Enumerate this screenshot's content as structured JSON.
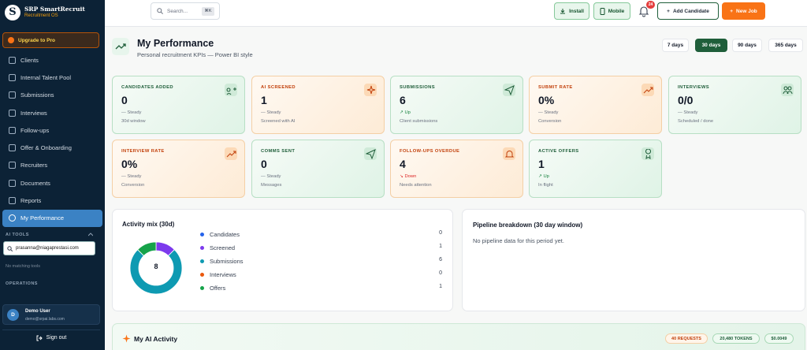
{
  "brand": {
    "logo_letter": "S",
    "name": "SRP SmartRecruit",
    "subtitle": "Recruitment OS"
  },
  "sidebar": {
    "upgrade_label": "Upgrade to Pro",
    "items": [
      {
        "label": "Clients",
        "icon": "briefcase-icon"
      },
      {
        "label": "Internal Talent Pool",
        "icon": "users-icon"
      },
      {
        "label": "Submissions",
        "icon": "send-icon"
      },
      {
        "label": "Interviews",
        "icon": "calendar-icon"
      },
      {
        "label": "Follow-ups",
        "icon": "clock-icon"
      },
      {
        "label": "Offer & Onboarding",
        "icon": "gift-icon"
      },
      {
        "label": "Recruiters",
        "icon": "user-icon"
      },
      {
        "label": "Documents",
        "icon": "file-icon"
      },
      {
        "label": "Reports",
        "icon": "bar-chart-icon"
      },
      {
        "label": "My Performance",
        "icon": "target-icon",
        "active": true
      }
    ],
    "ai_tools_label": "AI TOOLS",
    "search_value": "prasanna@niagaprestasi.com",
    "no_match": "No matching tools",
    "operations_label": "OPERATIONS",
    "user": {
      "initial": "D",
      "name": "Demo User",
      "email": "demo@srpai.labs.com"
    },
    "signout_label": "Sign out"
  },
  "topbar": {
    "search_placeholder": "Search...",
    "kbd": "⌘K",
    "install_label": "Install",
    "mobile_label": "Mobile",
    "notifications_count": "24",
    "add_candidate_label": "Add Candidate",
    "new_job_label": "New Job"
  },
  "page": {
    "title": "My Performance",
    "subtitle": "Personal recruitment KPIs — Power BI style",
    "ranges": [
      "7 days",
      "30 days",
      "90 days",
      "365 days"
    ],
    "active_range": "30 days"
  },
  "kpis": [
    {
      "label": "CANDIDATES ADDED",
      "value": "0",
      "trend": "— Steady",
      "trend_type": "steady",
      "note": "30d window",
      "tone": "green",
      "icon": "user-plus-icon"
    },
    {
      "label": "AI SCREENED",
      "value": "1",
      "trend": "— Steady",
      "trend_type": "steady",
      "note": "Screened with AI",
      "tone": "orange",
      "icon": "sparkle-icon"
    },
    {
      "label": "SUBMISSIONS",
      "value": "6",
      "trend": "↗ Up",
      "trend_type": "up",
      "note": "Client submissions",
      "tone": "green",
      "icon": "send-icon"
    },
    {
      "label": "SUBMIT RATE",
      "value": "0%",
      "trend": "— Steady",
      "trend_type": "steady",
      "note": "Conversion",
      "tone": "orange",
      "icon": "trending-up-icon"
    },
    {
      "label": "INTERVIEWS",
      "value": "0/0",
      "trend": "— Steady",
      "trend_type": "steady",
      "note": "Scheduled / done",
      "tone": "green",
      "icon": "users-icon"
    },
    {
      "label": "INTERVIEW RATE",
      "value": "0%",
      "trend": "— Steady",
      "trend_type": "steady",
      "note": "Conversion",
      "tone": "orange",
      "icon": "trending-up-icon"
    },
    {
      "label": "COMMS SENT",
      "value": "0",
      "trend": "— Steady",
      "trend_type": "steady",
      "note": "Messages",
      "tone": "green",
      "icon": "send-icon"
    },
    {
      "label": "FOLLOW-UPS OVERDUE",
      "value": "4",
      "trend": "↘ Down",
      "trend_type": "down",
      "note": "Needs attention",
      "tone": "orange",
      "icon": "bell-icon"
    },
    {
      "label": "ACTIVE OFFERS",
      "value": "1",
      "trend": "↗ Up",
      "trend_type": "up",
      "note": "In flight",
      "tone": "green",
      "icon": "award-icon"
    }
  ],
  "activity_mix": {
    "title": "Activity mix (30d)",
    "total": "8",
    "items": [
      {
        "label": "Candidates",
        "count": 0,
        "color": "#2563eb"
      },
      {
        "label": "Screened",
        "count": 1,
        "color": "#7c3aed"
      },
      {
        "label": "Submissions",
        "count": 6,
        "color": "#0e9ab2"
      },
      {
        "label": "Interviews",
        "count": 0,
        "color": "#ea580c"
      },
      {
        "label": "Offers",
        "count": 1,
        "color": "#16a34a"
      }
    ]
  },
  "pipeline": {
    "title": "Pipeline breakdown (30 day window)",
    "empty": "No pipeline data for this period yet."
  },
  "ai_activity": {
    "title": "My AI Activity",
    "requests": "40 REQUESTS",
    "tokens": "20,480 TOKENS",
    "cost": "$0.0049"
  }
}
